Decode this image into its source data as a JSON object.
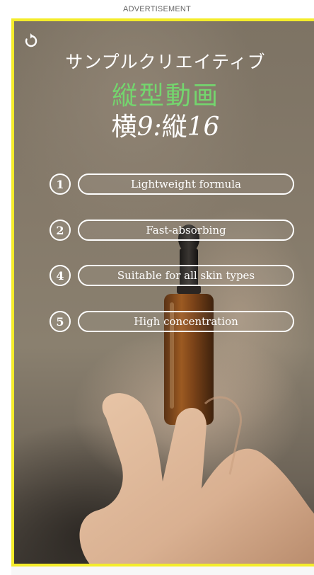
{
  "ad": {
    "label": "ADVERTISEMENT"
  },
  "creative": {
    "title_line1": "サンプルクリエイティブ",
    "title_line2": "縦型動画",
    "ratio_prefix": "横",
    "ratio_w": "9:",
    "ratio_mid": "縦",
    "ratio_h": "16",
    "accent_color": "#74d66e",
    "border_color": "#f4ec2a"
  },
  "features": [
    {
      "num": "1",
      "label": "Lightweight formula"
    },
    {
      "num": "2",
      "label": "Fast-absorbing"
    },
    {
      "num": "4",
      "label": "Suitable for all skin types"
    },
    {
      "num": "5",
      "label": "High concentration"
    }
  ],
  "controls": {
    "replay_icon": "replay-icon"
  }
}
